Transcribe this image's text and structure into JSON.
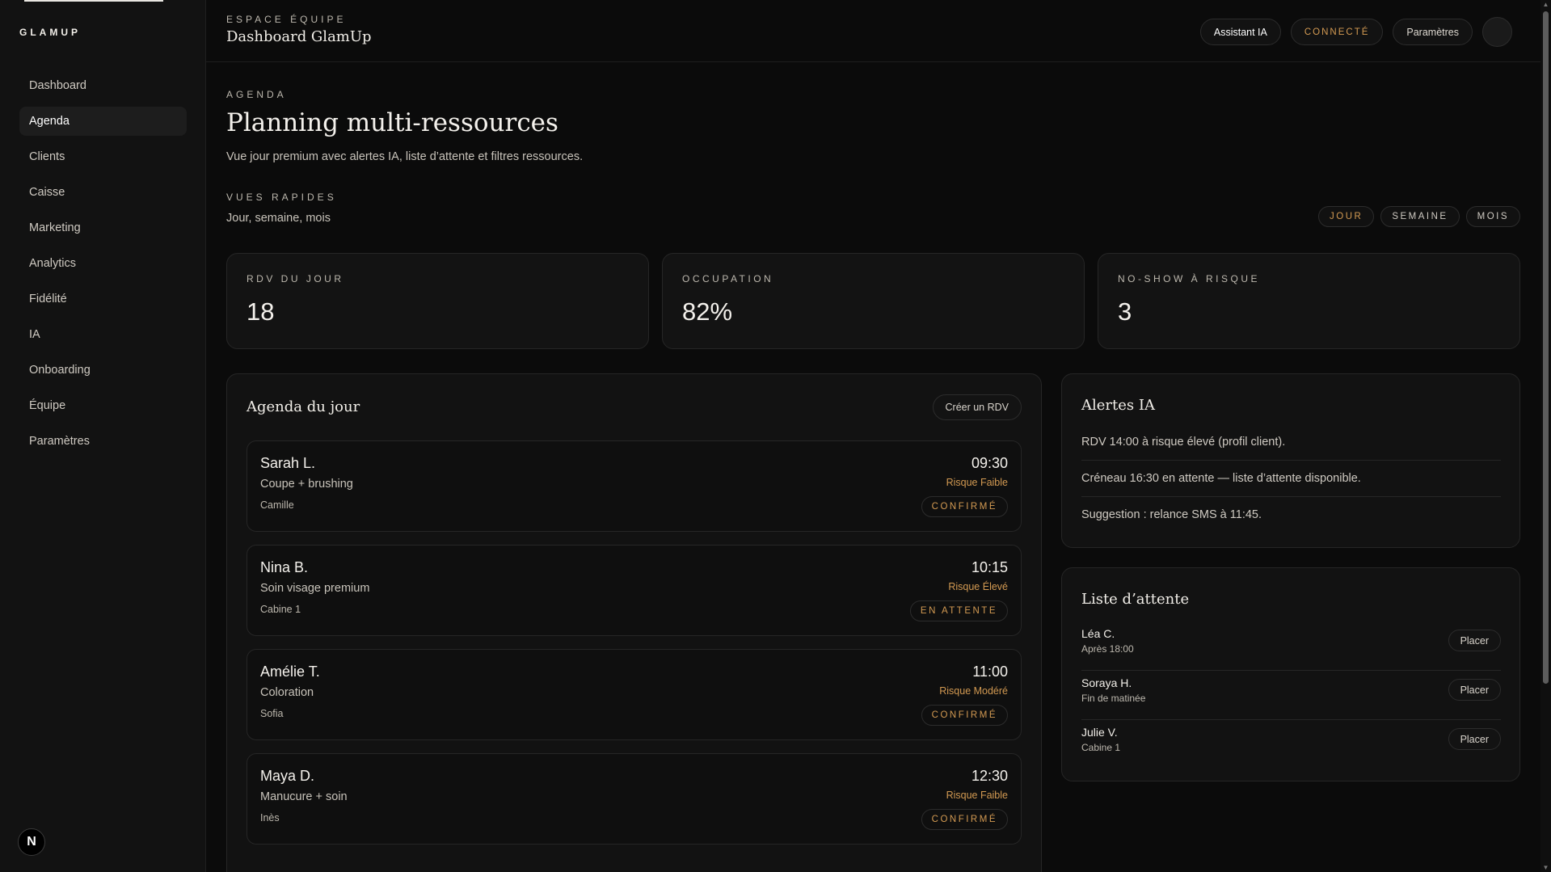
{
  "sidebar": {
    "brand": "GLAMUP",
    "items": [
      {
        "label": "Dashboard"
      },
      {
        "label": "Agenda",
        "active": true
      },
      {
        "label": "Clients"
      },
      {
        "label": "Caisse"
      },
      {
        "label": "Marketing"
      },
      {
        "label": "Analytics"
      },
      {
        "label": "Fidélité"
      },
      {
        "label": "IA"
      },
      {
        "label": "Onboarding"
      },
      {
        "label": "Équipe"
      },
      {
        "label": "Paramètres"
      }
    ],
    "badge": "N"
  },
  "header": {
    "eyebrow": "ESPACE ÉQUIPE",
    "title": "Dashboard GlamUp",
    "ai_button": "Assistant IA",
    "status": "CONNECTÉ",
    "settings_button": "Paramètres"
  },
  "page": {
    "eyebrow": "AGENDA",
    "title": "Planning multi-ressources",
    "subtitle": "Vue jour premium avec alertes IA, liste d’attente et filtres ressources.",
    "quick_eyebrow": "VUES RAPIDES",
    "quick_sub": "Jour, semaine, mois",
    "views": [
      {
        "label": "JOUR",
        "active": true
      },
      {
        "label": "SEMAINE"
      },
      {
        "label": "MOIS"
      }
    ]
  },
  "stats": [
    {
      "label": "RDV DU JOUR",
      "value": "18"
    },
    {
      "label": "OCCUPATION",
      "value": "82%"
    },
    {
      "label": "NO-SHOW À RISQUE",
      "value": "3"
    }
  ],
  "agenda": {
    "title": "Agenda du jour",
    "create_button": "Créer un RDV",
    "appointments": [
      {
        "name": "Sarah L.",
        "service": "Coupe + brushing",
        "resource": "Camille",
        "time": "09:30",
        "risk": "Risque Faible",
        "status": "CONFIRMÉ"
      },
      {
        "name": "Nina B.",
        "service": "Soin visage premium",
        "resource": "Cabine 1",
        "time": "10:15",
        "risk": "Risque Élevé",
        "status": "EN ATTENTE"
      },
      {
        "name": "Amélie T.",
        "service": "Coloration",
        "resource": "Sofia",
        "time": "11:00",
        "risk": "Risque Modéré",
        "status": "CONFIRMÉ"
      },
      {
        "name": "Maya D.",
        "service": "Manucure + soin",
        "resource": "Inès",
        "time": "12:30",
        "risk": "Risque Faible",
        "status": "CONFIRMÉ"
      }
    ]
  },
  "alerts": {
    "title": "Alertes IA",
    "items": [
      "RDV 14:00 à risque élevé (profil client).",
      "Créneau 16:30 en attente — liste d’attente disponible.",
      "Suggestion : relance SMS à 11:45."
    ]
  },
  "waitlist": {
    "title": "Liste d’attente",
    "place_label": "Placer",
    "items": [
      {
        "name": "Léa C.",
        "note": "Après 18:00"
      },
      {
        "name": "Soraya H.",
        "note": "Fin de matinée"
      },
      {
        "name": "Julie V.",
        "note": "Cabine 1"
      }
    ]
  },
  "colors": {
    "background": "#0b0b0b",
    "panel": "#121212",
    "accent": "#d39a52",
    "text": "#e9e6e1"
  }
}
